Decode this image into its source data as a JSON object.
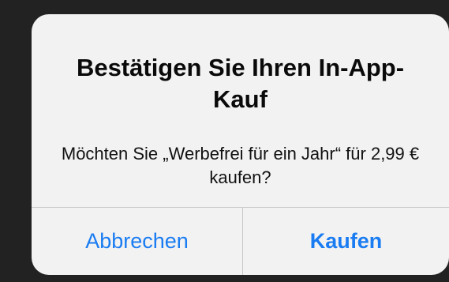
{
  "dialog": {
    "title": "Bestätigen Sie Ihren In-App-Kauf",
    "message": "Möchten Sie „Werbefrei für ein Jahr“ für 2,99 € kaufen?",
    "cancel_label": "Abbrechen",
    "confirm_label": "Kaufen"
  },
  "colors": {
    "accent": "#1a7cf2",
    "dialog_background": "#f2f2f2",
    "backdrop": "#222222"
  }
}
